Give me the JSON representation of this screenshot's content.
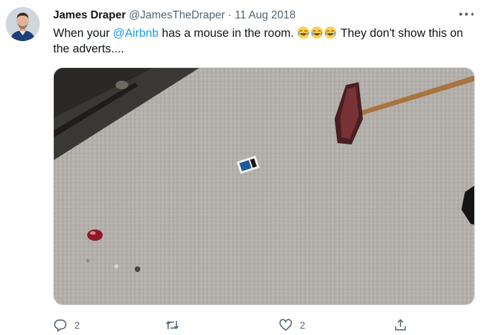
{
  "tweet": {
    "author_name": "James Draper",
    "author_handle": "@JamesTheDraper",
    "separator": "·",
    "date": "11 Aug 2018",
    "text_before": "When your ",
    "mention": "@Airbnb",
    "text_after_mention": " has a mouse in the room. ",
    "emoji_name": "face-with-tears-of-joy",
    "emoji_count": 3,
    "text_after_emoji": " They don't show this on the adverts...."
  },
  "actions": {
    "reply_count": "2",
    "retweet_count": "",
    "like_count": "2"
  },
  "icons": {
    "more": "more-horizontal-icon",
    "reply": "reply-icon",
    "retweet": "retweet-icon",
    "like": "heart-icon",
    "share": "share-icon"
  },
  "colors": {
    "link": "#1d9bf0",
    "secondary_text": "#536471",
    "primary_text": "#0f1419"
  }
}
